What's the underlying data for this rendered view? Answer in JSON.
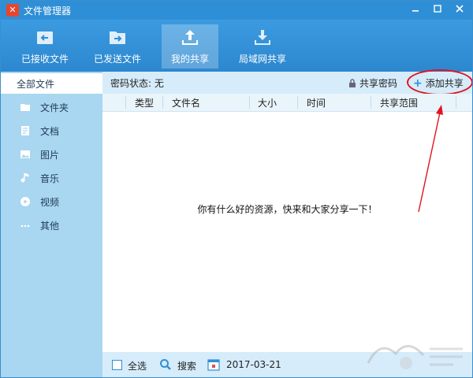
{
  "window": {
    "title": "文件管理器"
  },
  "toolbar": {
    "items": [
      {
        "label": "已接收文件",
        "icon": "inbox-arrow-left-icon"
      },
      {
        "label": "已发送文件",
        "icon": "folder-arrow-right-icon"
      },
      {
        "label": "我的共享",
        "icon": "upload-icon",
        "active": true
      },
      {
        "label": "局域网共享",
        "icon": "download-icon"
      }
    ]
  },
  "sidebar": {
    "items": [
      {
        "label": "全部文件",
        "active": true
      },
      {
        "label": "文件夹",
        "icon": "folder-icon"
      },
      {
        "label": "文档",
        "icon": "document-icon"
      },
      {
        "label": "图片",
        "icon": "image-icon"
      },
      {
        "label": "音乐",
        "icon": "music-note-icon"
      },
      {
        "label": "视频",
        "icon": "play-circle-icon"
      },
      {
        "label": "其他",
        "icon": "more-dots-icon"
      }
    ]
  },
  "status": {
    "password_state": "密码状态: 无",
    "share_password_label": "共享密码",
    "add_share_label": "添加共享"
  },
  "table": {
    "columns": [
      "类型",
      "文件名",
      "大小",
      "时间",
      "共享范围"
    ]
  },
  "empty_message": "你有什么好的资源，快来和大家分享一下！",
  "footer": {
    "select_all": "全选",
    "search": "搜索",
    "date": "2017-03-21"
  },
  "colors": {
    "accent": "#2f8fd6",
    "sidebar": "#a9d6f0",
    "annotation": "#e0141e"
  }
}
